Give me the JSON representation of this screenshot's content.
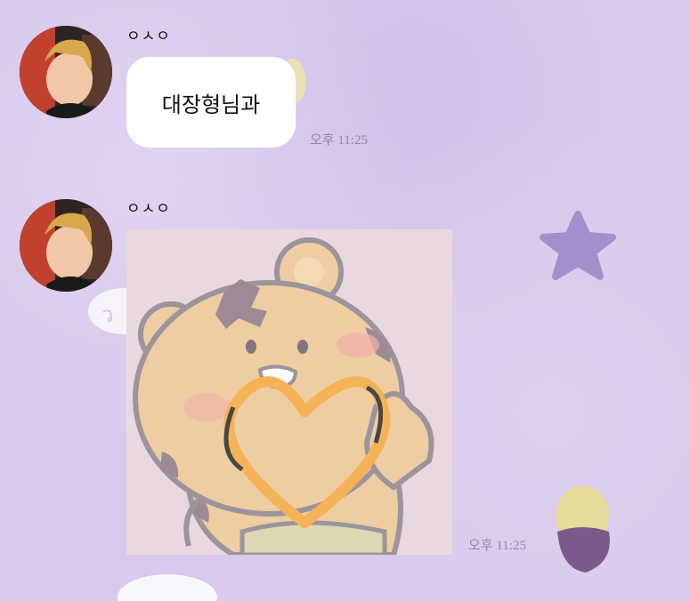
{
  "messages": [
    {
      "sender": "ㅇㅅㅇ",
      "type": "text",
      "text": "대장형님과",
      "time": "오후 11:25",
      "avatar_icon": "profile-photo"
    },
    {
      "sender": "ㅇㅅㅇ",
      "type": "image",
      "image_icon": "tiger-bear-heart-sticker-photo",
      "time": "오후 11:25",
      "avatar_icon": "profile-photo"
    }
  ],
  "colors": {
    "background": "#d9c9ec",
    "bubble": "#ffffff",
    "timestamp": "#8e8a98"
  }
}
